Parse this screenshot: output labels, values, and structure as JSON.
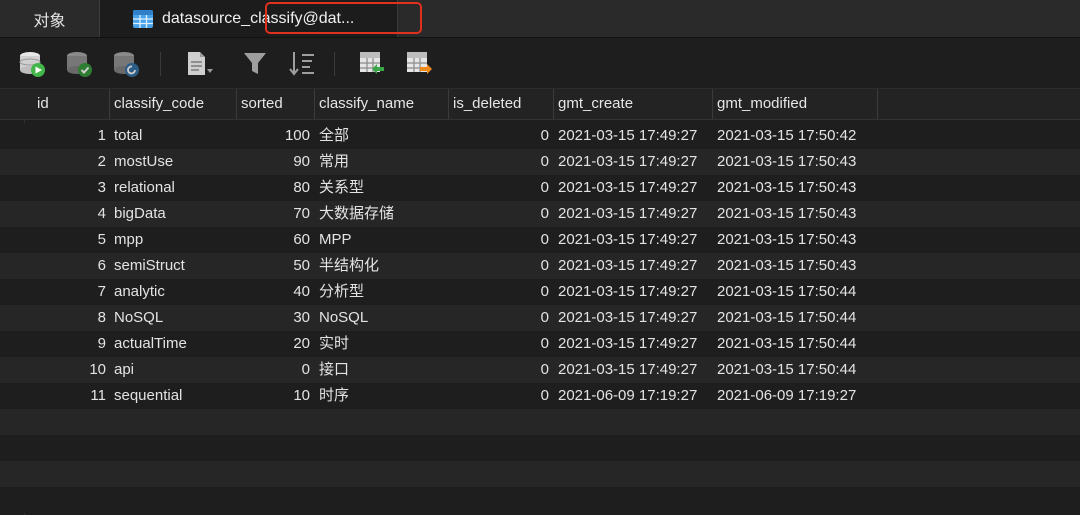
{
  "tabs": {
    "objects_label": "对象",
    "table_label": "datasource_classify@dat..."
  },
  "toolbar": {
    "buttons": [
      "begin-transaction-icon",
      "commit-icon",
      "rollback-icon",
      "text-view-icon",
      "filter-icon",
      "sort-icon",
      "import-icon",
      "export-icon"
    ]
  },
  "grid": {
    "columns": [
      "id",
      "classify_code",
      "sorted",
      "classify_name",
      "is_deleted",
      "gmt_create",
      "gmt_modified"
    ],
    "rows": [
      {
        "id": "1",
        "classify_code": "total",
        "sorted": "100",
        "classify_name": "全部",
        "is_deleted": "0",
        "gmt_create": "2021-03-15 17:49:27",
        "gmt_modified": "2021-03-15 17:50:42"
      },
      {
        "id": "2",
        "classify_code": "mostUse",
        "sorted": "90",
        "classify_name": "常用",
        "is_deleted": "0",
        "gmt_create": "2021-03-15 17:49:27",
        "gmt_modified": "2021-03-15 17:50:43"
      },
      {
        "id": "3",
        "classify_code": "relational",
        "sorted": "80",
        "classify_name": "关系型",
        "is_deleted": "0",
        "gmt_create": "2021-03-15 17:49:27",
        "gmt_modified": "2021-03-15 17:50:43"
      },
      {
        "id": "4",
        "classify_code": "bigData",
        "sorted": "70",
        "classify_name": "大数据存储",
        "is_deleted": "0",
        "gmt_create": "2021-03-15 17:49:27",
        "gmt_modified": "2021-03-15 17:50:43"
      },
      {
        "id": "5",
        "classify_code": "mpp",
        "sorted": "60",
        "classify_name": "MPP",
        "is_deleted": "0",
        "gmt_create": "2021-03-15 17:49:27",
        "gmt_modified": "2021-03-15 17:50:43"
      },
      {
        "id": "6",
        "classify_code": "semiStruct",
        "sorted": "50",
        "classify_name": "半结构化",
        "is_deleted": "0",
        "gmt_create": "2021-03-15 17:49:27",
        "gmt_modified": "2021-03-15 17:50:43"
      },
      {
        "id": "7",
        "classify_code": "analytic",
        "sorted": "40",
        "classify_name": "分析型",
        "is_deleted": "0",
        "gmt_create": "2021-03-15 17:49:27",
        "gmt_modified": "2021-03-15 17:50:44"
      },
      {
        "id": "8",
        "classify_code": "NoSQL",
        "sorted": "30",
        "classify_name": "NoSQL",
        "is_deleted": "0",
        "gmt_create": "2021-03-15 17:49:27",
        "gmt_modified": "2021-03-15 17:50:44"
      },
      {
        "id": "9",
        "classify_code": "actualTime",
        "sorted": "20",
        "classify_name": "实时",
        "is_deleted": "0",
        "gmt_create": "2021-03-15 17:49:27",
        "gmt_modified": "2021-03-15 17:50:44"
      },
      {
        "id": "10",
        "classify_code": "api",
        "sorted": "0",
        "classify_name": "接口",
        "is_deleted": "0",
        "gmt_create": "2021-03-15 17:49:27",
        "gmt_modified": "2021-03-15 17:50:44"
      },
      {
        "id": "11",
        "classify_code": "sequential",
        "sorted": "10",
        "classify_name": "时序",
        "is_deleted": "0",
        "gmt_create": "2021-06-09 17:19:27",
        "gmt_modified": "2021-06-09 17:19:27"
      }
    ]
  }
}
